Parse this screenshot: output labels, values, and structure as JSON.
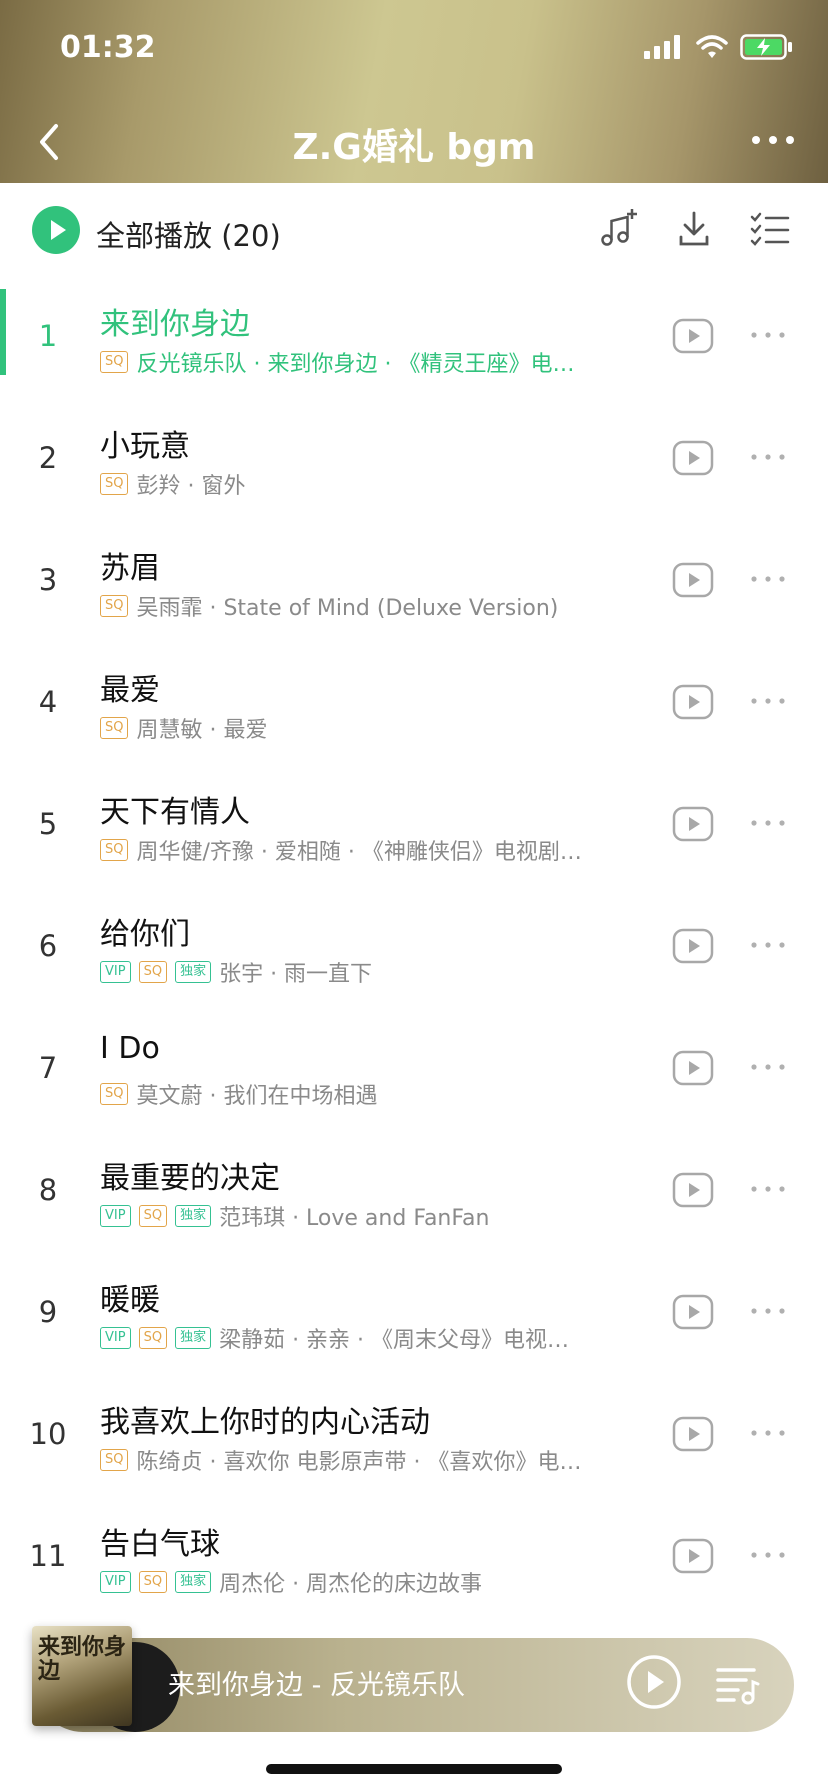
{
  "status_bar": {
    "time": "01:32"
  },
  "nav": {
    "title": "Z.G婚礼 bgm"
  },
  "toolbar": {
    "play_all_label": "全部播放",
    "count": "(20)"
  },
  "songs": [
    {
      "index": "1",
      "title": "来到你身边",
      "tags": [
        "SQ"
      ],
      "meta": "反光镜乐队 · 来到你身边 · 《精灵王座》电…",
      "active": true
    },
    {
      "index": "2",
      "title": "小玩意",
      "tags": [
        "SQ"
      ],
      "meta": "彭羚 · 窗外"
    },
    {
      "index": "3",
      "title": "苏眉",
      "tags": [
        "SQ"
      ],
      "meta": "吴雨霏 · State of Mind (Deluxe Version)"
    },
    {
      "index": "4",
      "title": "最爱",
      "tags": [
        "SQ"
      ],
      "meta": "周慧敏 · 最爱"
    },
    {
      "index": "5",
      "title": "天下有情人",
      "tags": [
        "SQ"
      ],
      "meta": "周华健/齐豫 · 爱相随 · 《神雕侠侣》电视剧…"
    },
    {
      "index": "6",
      "title": "给你们",
      "tags": [
        "VIP",
        "SQ",
        "独家"
      ],
      "meta": "张宇 · 雨一直下"
    },
    {
      "index": "7",
      "title": "I Do",
      "tags": [
        "SQ"
      ],
      "meta": "莫文蔚 · 我们在中场相遇"
    },
    {
      "index": "8",
      "title": "最重要的决定",
      "tags": [
        "VIP",
        "SQ",
        "独家"
      ],
      "meta": "范玮琪 · Love and FanFan"
    },
    {
      "index": "9",
      "title": "暖暖",
      "tags": [
        "VIP",
        "SQ",
        "独家"
      ],
      "meta": "梁静茹 · 亲亲 · 《周末父母》电视…"
    },
    {
      "index": "10",
      "title": "我喜欢上你时的内心活动",
      "tags": [
        "SQ"
      ],
      "meta": "陈绮贞 · 喜欢你 电影原声带 · 《喜欢你》电…"
    },
    {
      "index": "11",
      "title": "告白气球",
      "tags": [
        "VIP",
        "SQ",
        "独家"
      ],
      "meta": "周杰伦 · 周杰伦的床边故事"
    }
  ],
  "mini_player": {
    "title": "来到你身边 - 反光镜乐队",
    "cover_text": "来到你身边"
  },
  "colors": {
    "accent": "#31c27c",
    "sq_tag": "#e2a54a",
    "vip_tag": "#35c192"
  }
}
